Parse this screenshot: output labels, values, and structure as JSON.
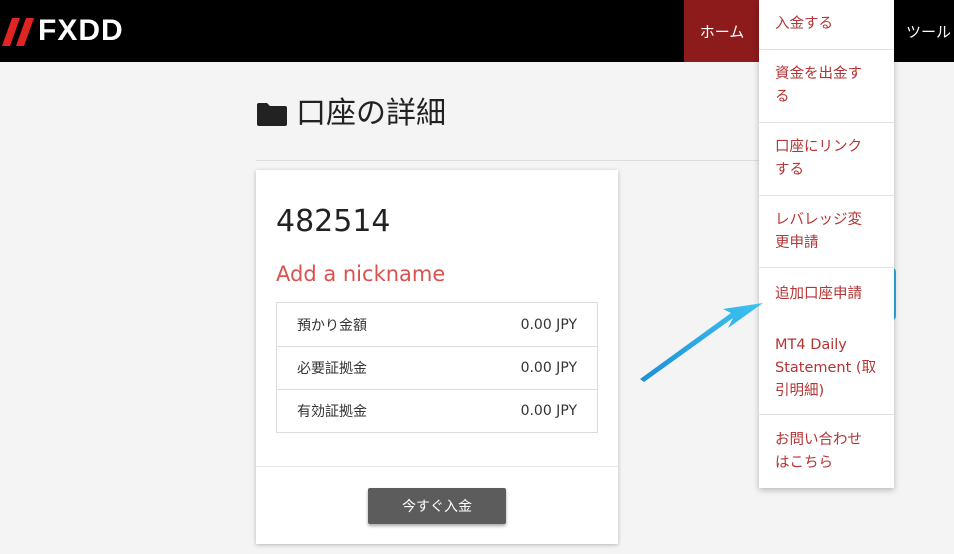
{
  "header": {
    "logo_text": "FXDD",
    "nav_home": "ホーム",
    "nav_tools": "ツール"
  },
  "page": {
    "title": "口座の詳細"
  },
  "account": {
    "number": "482514",
    "nickname_link": "Add a nickname",
    "balances": [
      {
        "label": "預かり金額",
        "value": "0.00 JPY"
      },
      {
        "label": "必要証拠金",
        "value": "0.00 JPY"
      },
      {
        "label": "有効証拠金",
        "value": "0.00 JPY"
      }
    ],
    "deposit_button": "今すぐ入金"
  },
  "dropdown": {
    "items": [
      {
        "line1": "入金する",
        "line2": ""
      },
      {
        "line1": "資金を出金す",
        "line2": "る"
      },
      {
        "line1": "口座にリンク",
        "line2": "する"
      },
      {
        "line1": "レバレッジ変",
        "line2": "更申請"
      },
      {
        "line1": "追加口座申請",
        "line2": ""
      },
      {
        "line1": "MT4 Daily",
        "line2": "Statement (取",
        "line3": "引明細)"
      },
      {
        "line1": "お問い合わせ",
        "line2": "はこちら"
      }
    ]
  },
  "colors": {
    "header_bg": "#000000",
    "nav_active": "#8e1b1b",
    "link_red": "#d9534f",
    "menu_red": "#b53434",
    "highlight": "#29abe2",
    "button_gray": "#5c5c5c"
  },
  "icons": {
    "title_icon": "folder-icon",
    "logo_mark": "logo-slashes-icon",
    "annotation": "arrow-icon"
  }
}
